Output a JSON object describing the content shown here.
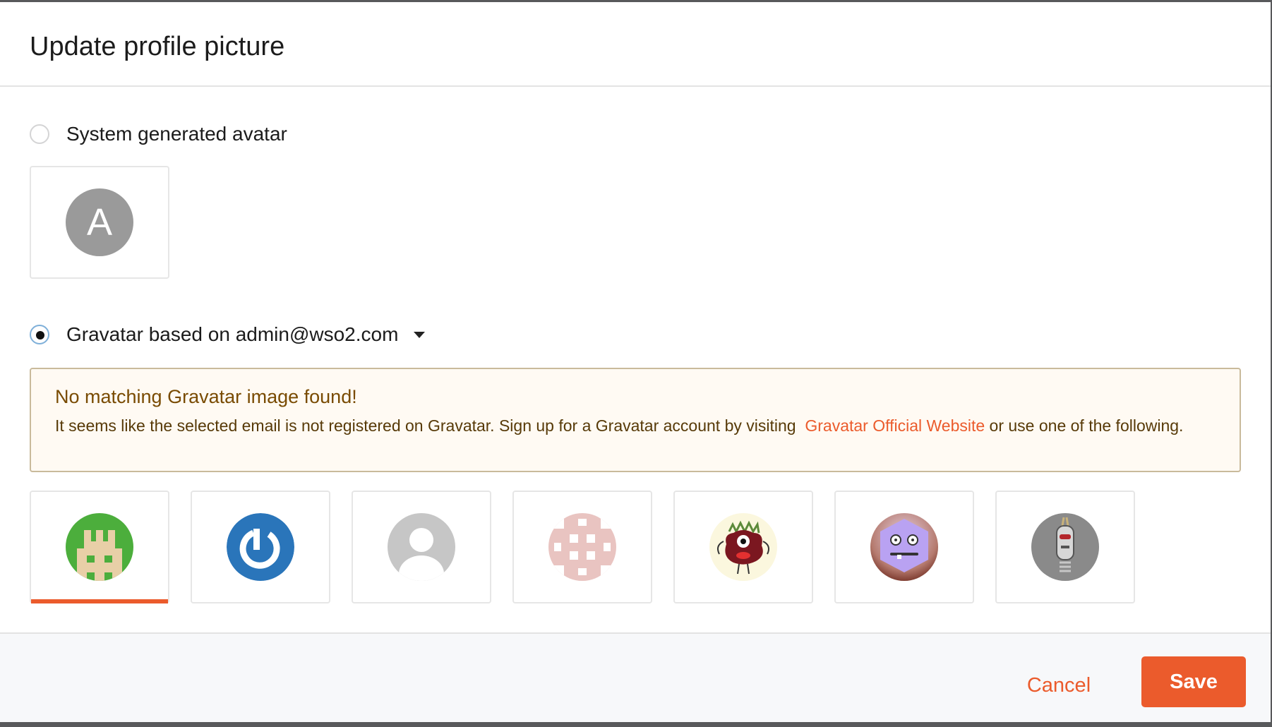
{
  "modal": {
    "title": "Update profile picture"
  },
  "system_avatar": {
    "label": "System generated avatar",
    "selected": false,
    "initial": "A",
    "avatar_color": "#9a9a9a"
  },
  "gravatar": {
    "label": "Gravatar based on admin@wso2.com",
    "selected": true
  },
  "warning": {
    "title": "No matching Gravatar image found!",
    "text_before": "It seems like the selected email is not registered on Gravatar. Sign up for a Gravatar account by visiting",
    "link_text": "Gravatar Official Website",
    "text_after": "or use one of the following."
  },
  "gravatar_options": [
    {
      "name": "retro-avatar",
      "icon": "retro-castle-icon",
      "selected": true
    },
    {
      "name": "gravatar-logo",
      "icon": "gravatar-logo-icon",
      "selected": false
    },
    {
      "name": "mystery-person",
      "icon": "mystery-person-icon",
      "selected": false
    },
    {
      "name": "identicon",
      "icon": "identicon-pattern-icon",
      "selected": false
    },
    {
      "name": "monsterid",
      "icon": "monster-face-icon",
      "selected": false
    },
    {
      "name": "wavatar",
      "icon": "wavatar-face-icon",
      "selected": false
    },
    {
      "name": "robohash",
      "icon": "robot-face-icon",
      "selected": false
    }
  ],
  "footer": {
    "cancel_label": "Cancel",
    "save_label": "Save"
  },
  "colors": {
    "accent": "#eb5b2c",
    "warning_bg": "#fffaf3",
    "warning_border": "#c9ba9b"
  }
}
